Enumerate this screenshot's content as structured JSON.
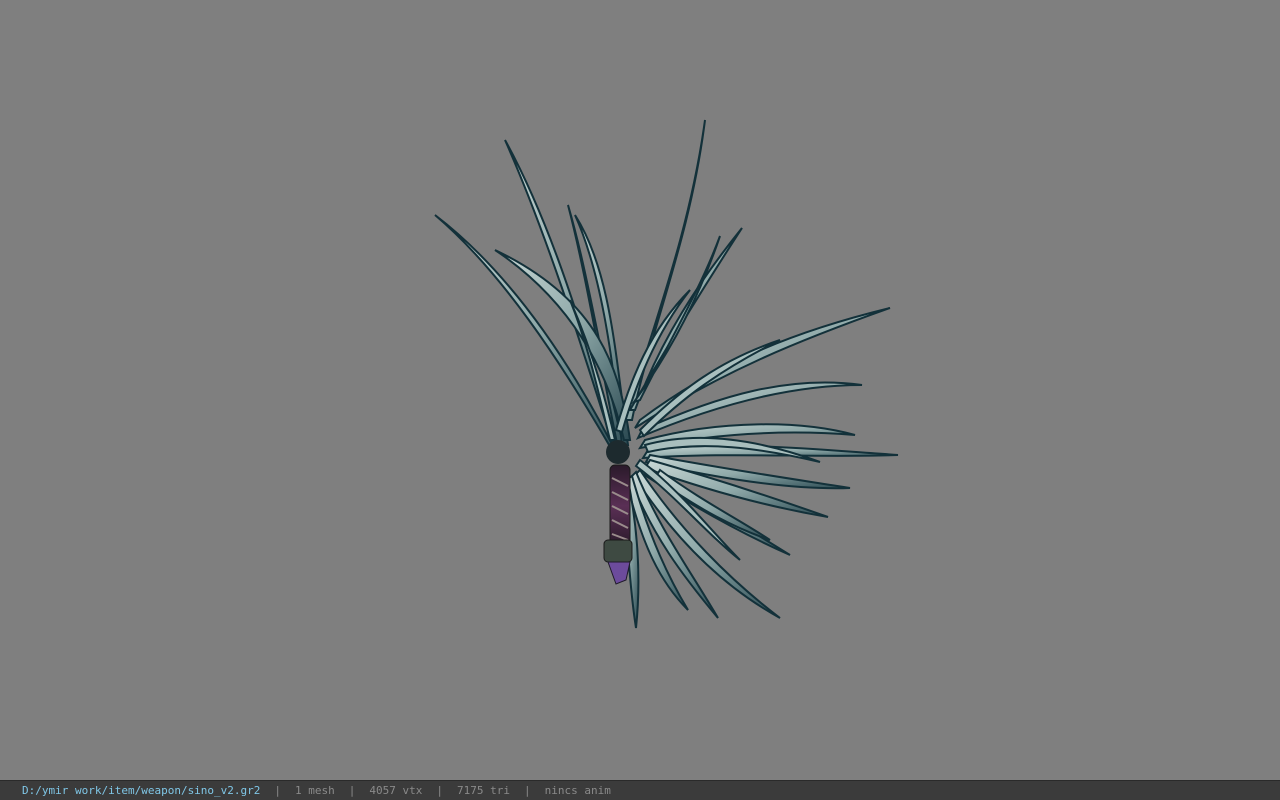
{
  "viewer": {
    "background_color": "#7f7f7f",
    "model_icon": "spiked-weapon-model"
  },
  "statusbar": {
    "path": "D:/ymir work/item/weapon/sino_v2.gr2",
    "separator": "|",
    "mesh": "1 mesh",
    "vertices": "4057 vtx",
    "triangles": "7175 tri",
    "animation": "nincs anim",
    "path_color": "#7fc6e6"
  }
}
